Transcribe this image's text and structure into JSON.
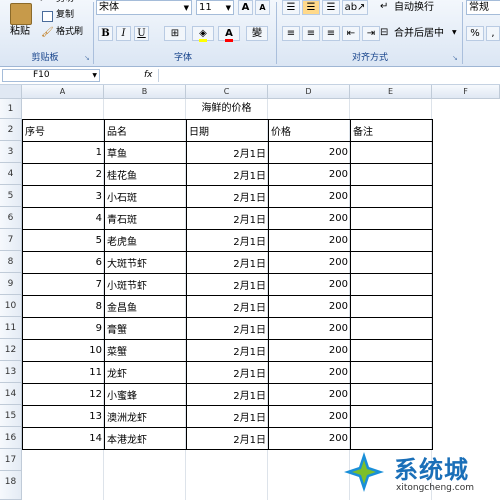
{
  "ribbon": {
    "clipboard": {
      "paste": "粘贴",
      "cut": "剪切",
      "copy": "复制",
      "format_painter": "格式刷",
      "group_label": "剪贴板"
    },
    "font": {
      "name": "宋体",
      "size": "11",
      "bold": "B",
      "italic": "I",
      "underline": "U",
      "group_label": "字体",
      "phonetic": "變"
    },
    "alignment": {
      "wrap_text": "自动换行",
      "merge_center": "合并后居中",
      "group_label": "对齐方式"
    },
    "number": {
      "format": "常规"
    }
  },
  "formula_bar": {
    "name_box": "F10",
    "fx": "fx",
    "content": ""
  },
  "columns": [
    "A",
    "B",
    "C",
    "D",
    "E",
    "F"
  ],
  "rows": [
    "1",
    "2",
    "3",
    "4",
    "5",
    "6",
    "7",
    "8",
    "9",
    "10",
    "11",
    "12",
    "13",
    "14",
    "15",
    "16",
    "17",
    "18"
  ],
  "sheet": {
    "title": "海鲜的价格",
    "headers": [
      "序号",
      "品名",
      "日期",
      "价格",
      "备注"
    ],
    "records": [
      {
        "no": "1",
        "name": "草鱼",
        "date": "2月1日",
        "price": "200"
      },
      {
        "no": "2",
        "name": "桂花鱼",
        "date": "2月1日",
        "price": "200"
      },
      {
        "no": "3",
        "name": "小石斑",
        "date": "2月1日",
        "price": "200"
      },
      {
        "no": "4",
        "name": "青石斑",
        "date": "2月1日",
        "price": "200"
      },
      {
        "no": "5",
        "name": "老虎鱼",
        "date": "2月1日",
        "price": "200"
      },
      {
        "no": "6",
        "name": "大斑节虾",
        "date": "2月1日",
        "price": "200"
      },
      {
        "no": "7",
        "name": "小斑节虾",
        "date": "2月1日",
        "price": "200"
      },
      {
        "no": "8",
        "name": "金昌鱼",
        "date": "2月1日",
        "price": "200"
      },
      {
        "no": "9",
        "name": "膏蟹",
        "date": "2月1日",
        "price": "200"
      },
      {
        "no": "10",
        "name": "菜蟹",
        "date": "2月1日",
        "price": "200"
      },
      {
        "no": "11",
        "name": "龙虾",
        "date": "2月1日",
        "price": "200"
      },
      {
        "no": "12",
        "name": "小蜜蜂",
        "date": "2月1日",
        "price": "200"
      },
      {
        "no": "13",
        "name": "澳洲龙虾",
        "date": "2月1日",
        "price": "200"
      },
      {
        "no": "14",
        "name": "本港龙虾",
        "date": "2月1日",
        "price": "200"
      }
    ]
  },
  "watermark": {
    "brand": "系统城",
    "url": "xitongcheng.com"
  },
  "colors": {
    "ribbon_text": "#15428b",
    "logo_blue": "#1a8fd8",
    "logo_green": "#7cbf2a"
  }
}
